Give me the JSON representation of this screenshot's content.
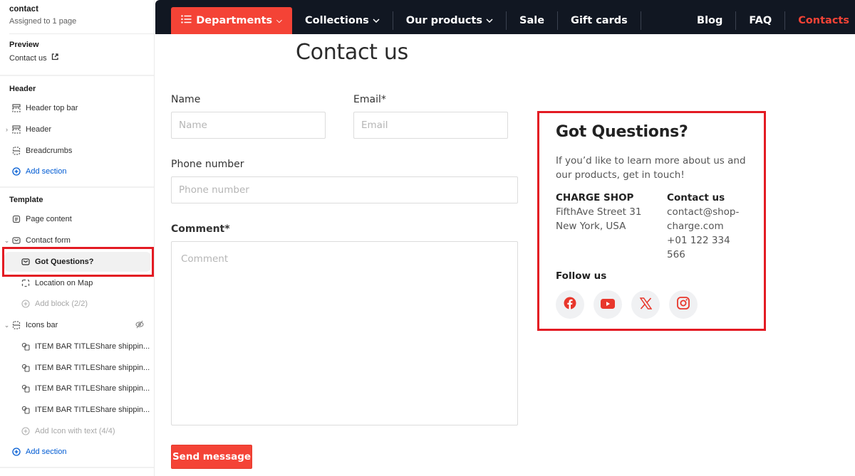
{
  "sidebar": {
    "template_name": "contact",
    "assigned": "Assigned to 1 page",
    "preview_label": "Preview",
    "preview_link": "Contact us",
    "header_group": "Header",
    "header_items": [
      {
        "label": "Header top bar",
        "icon": "section-icon"
      },
      {
        "label": "Header",
        "icon": "section-icon",
        "expandable": true
      },
      {
        "label": "Breadcrumbs",
        "icon": "section-icon"
      }
    ],
    "add_section": "Add section",
    "template_group": "Template",
    "page_content": "Page content",
    "contact_form": "Contact form",
    "got_questions": "Got Questions?",
    "location_on_map": "Location on Map",
    "add_block": "Add block (2/2)",
    "icons_bar": "Icons bar",
    "icon_items": [
      "ITEM BAR TITLEShare shippin...",
      "ITEM BAR TITLEShare shippin...",
      "ITEM BAR TITLEShare shippin...",
      "ITEM BAR TITLEShare shippin..."
    ],
    "add_icon_text": "Add Icon with text (4/4)",
    "add_section_2": "Add section"
  },
  "nav": {
    "departments": "Departments",
    "items": [
      "Collections",
      "Our products",
      "Sale",
      "Gift cards"
    ],
    "right_items": [
      "Blog",
      "FAQ",
      "Contacts"
    ],
    "active": "Contacts"
  },
  "page": {
    "title": "Contact us"
  },
  "form": {
    "name_label": "Name",
    "name_placeholder": "Name",
    "email_label": "Email*",
    "email_placeholder": "Email",
    "phone_label": "Phone number",
    "phone_placeholder": "Phone number",
    "comment_label": "Comment*",
    "comment_placeholder": "Comment",
    "submit": "Send message"
  },
  "info": {
    "title": "Got Questions?",
    "description": "If you’d like to learn more about us and our products, get in touch!",
    "shop_name": "CHARGE SHOP",
    "address_line1": "FifthAve Street 31",
    "address_line2": "New York, USA",
    "contact_heading": "Contact us",
    "email_line1": "contact@shop-",
    "email_line2": "charge.com",
    "phone": "+01 122 334 566",
    "follow_label": "Follow us",
    "socials": [
      "facebook",
      "youtube",
      "x",
      "instagram"
    ]
  },
  "colors": {
    "accent": "#f44336",
    "nav_bg": "#111722",
    "highlight_border": "#e31b23",
    "link_blue": "#005bd3"
  }
}
